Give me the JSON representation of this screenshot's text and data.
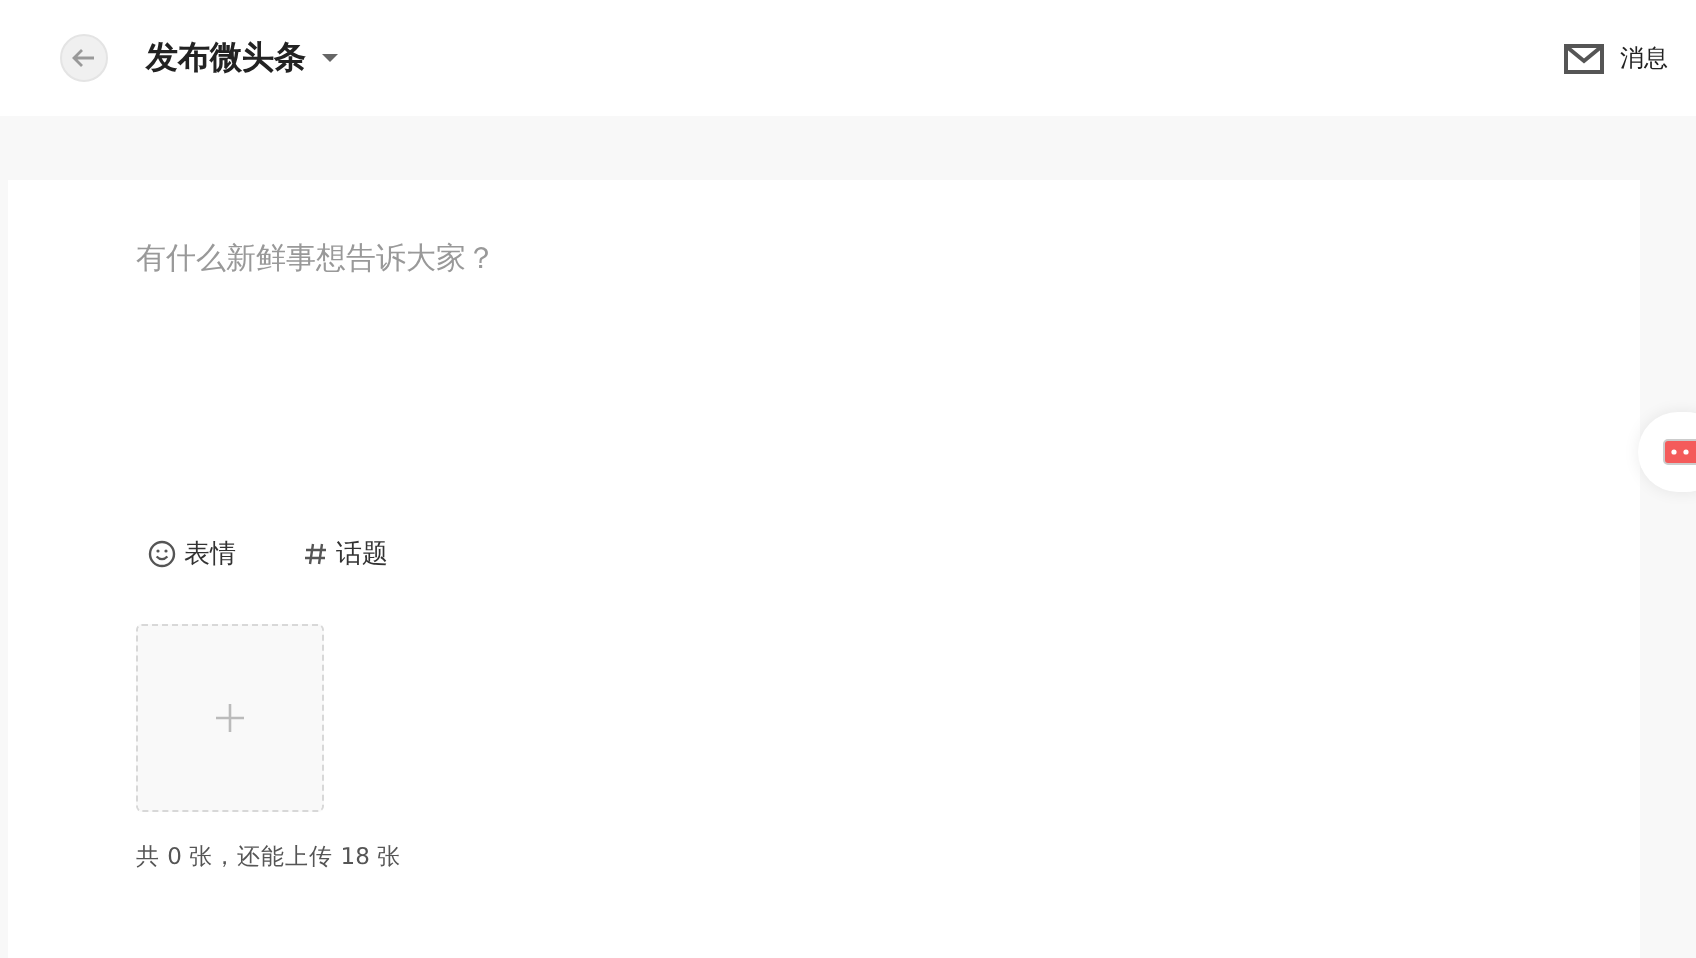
{
  "header": {
    "title": "发布微头条",
    "messages_label": "消息"
  },
  "composer": {
    "placeholder": "有什么新鲜事想告诉大家？",
    "tools": [
      {
        "kind": "emoji",
        "label": "表情"
      },
      {
        "kind": "hashtag",
        "label": "话题"
      }
    ],
    "upload_hint": "共 0 张，还能上传 18 张"
  }
}
